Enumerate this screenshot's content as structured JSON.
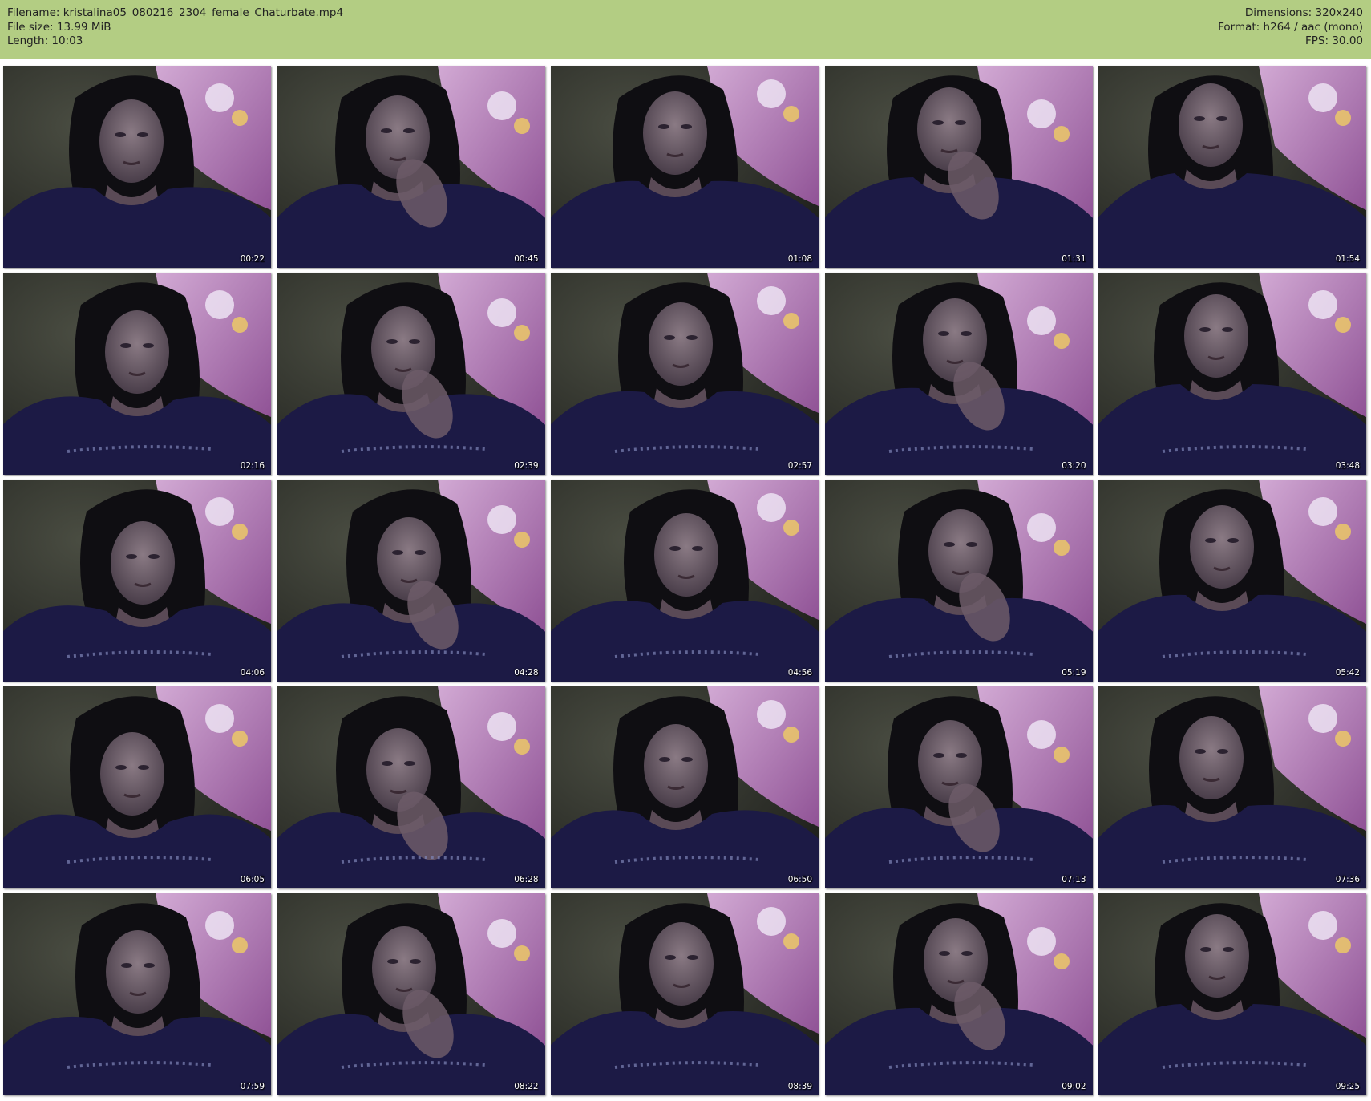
{
  "meta": {
    "filename": "Filename: kristalina05_080216_2304_female_Chaturbate.mp4",
    "filesize": "File size: 13.99 MiB",
    "length": "Length: 10:03",
    "dimensions": "Dimensions: 320x240",
    "format": "Format: h264 / aac (mono)",
    "fps": "FPS: 30.00"
  },
  "colors": {
    "header_bg": "#b3cd83",
    "pillow_pink": "#c27ec4",
    "shirt_navy": "#1c1a45",
    "background_dark": "#2a2c26"
  },
  "thumbnails": [
    {
      "timestamp": "00:22"
    },
    {
      "timestamp": "00:45"
    },
    {
      "timestamp": "01:08"
    },
    {
      "timestamp": "01:31"
    },
    {
      "timestamp": "01:54"
    },
    {
      "timestamp": "02:16"
    },
    {
      "timestamp": "02:39"
    },
    {
      "timestamp": "02:57"
    },
    {
      "timestamp": "03:20"
    },
    {
      "timestamp": "03:48"
    },
    {
      "timestamp": "04:06"
    },
    {
      "timestamp": "04:28"
    },
    {
      "timestamp": "04:56"
    },
    {
      "timestamp": "05:19"
    },
    {
      "timestamp": "05:42"
    },
    {
      "timestamp": "06:05"
    },
    {
      "timestamp": "06:28"
    },
    {
      "timestamp": "06:50"
    },
    {
      "timestamp": "07:13"
    },
    {
      "timestamp": "07:36"
    },
    {
      "timestamp": "07:59"
    },
    {
      "timestamp": "08:22"
    },
    {
      "timestamp": "08:39"
    },
    {
      "timestamp": "09:02"
    },
    {
      "timestamp": "09:25"
    }
  ]
}
